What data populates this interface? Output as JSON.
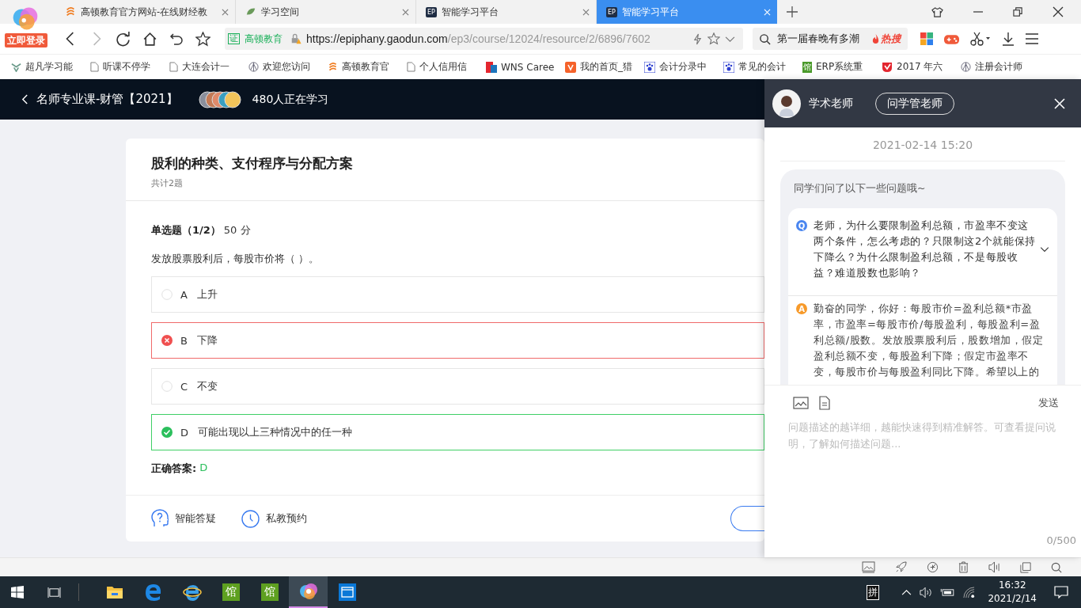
{
  "browser": {
    "login_badge": "立即登录",
    "tabs": [
      {
        "title": "高顿教育官方网站-在线财经教",
        "kind": "gaodun",
        "selected": false
      },
      {
        "title": "学习空间",
        "kind": "leaf",
        "selected": false
      },
      {
        "title": "智能学习平台",
        "kind": "ep",
        "badge": "EP",
        "selected": false
      },
      {
        "title": "智能学习平台",
        "kind": "ep",
        "badge": "EP",
        "selected": true
      }
    ],
    "cert_badge": "证",
    "site_name": "高顿教育",
    "url_host": "https://epiphany.gaodun.com",
    "url_path": "/ep3/course/12024/resource/2/6896/7602",
    "search": {
      "value": "第一届春晚有多潮",
      "hot": "热搜"
    },
    "bookmarks": [
      {
        "title": "超凡学习能",
        "kind": "leaf"
      },
      {
        "title": "听课不停学",
        "kind": "doc"
      },
      {
        "title": "大连会计一",
        "kind": "doc"
      },
      {
        "title": "欢迎您访问",
        "kind": "globe"
      },
      {
        "title": "高顿教育官",
        "kind": "gaodun"
      },
      {
        "title": "个人信用信",
        "kind": "doc"
      },
      {
        "title": "WNS Caree",
        "kind": "wns"
      },
      {
        "title": "我的首页_猎",
        "kind": "orange"
      },
      {
        "title": "会计分录中",
        "kind": "paw"
      },
      {
        "title": "常见的会计",
        "kind": "paw"
      },
      {
        "title": "ERP系统重",
        "kind": "guan",
        "badge": "馆"
      },
      {
        "title": "2017 年六",
        "kind": "red"
      },
      {
        "title": "注册会计师",
        "kind": "globe"
      }
    ]
  },
  "header": {
    "course": "名师专业课-财管【2021】",
    "learners": "480人正在学习"
  },
  "card": {
    "title": "股利的种类、支付程序与分配方案",
    "count": "共计2题",
    "qtype": "单选题（1/2）",
    "score": "50 分",
    "question": "发放股票股利后，每股市价将（ ）。",
    "options": [
      {
        "letter": "A",
        "text": "上升",
        "selected": false,
        "correct": false
      },
      {
        "letter": "B",
        "text": "下降",
        "selected": true,
        "correct": false
      },
      {
        "letter": "C",
        "text": "不变",
        "selected": false,
        "correct": false
      },
      {
        "letter": "D",
        "text": "可能出现以上三种情况中的任一种",
        "selected": false,
        "correct": true
      }
    ],
    "answer_label": "正确答案:",
    "answer_value": "D",
    "actions": [
      {
        "label": "智能答疑",
        "kind": "qa"
      },
      {
        "label": "私教预约",
        "kind": "clock"
      }
    ]
  },
  "panel": {
    "teacher": "学术老师",
    "ask_button": "问学管老师",
    "date": "2021-02-14 15:20",
    "intro": "同学们问了以下一些问题哦~",
    "q_mark": "Q",
    "question": "老师，为什么要限制盈利总额，市盈率不变这两个条件，怎么考虑的？只限制这2个就能保持下降么？为什么限制盈利总额，不是每股收益？难道股数也影响？",
    "a_mark": "A",
    "answer": "勤奋的同学，你好：每股市价=盈利总额*市盈率，市盈率=每股市价/每股盈利，每股盈利=盈利总额/股数。发放股票股利后，股数增加，假定盈利总额不变，每股盈利下降；假定市盈率不变，每股市价与每股盈利同比下降。希望以上的",
    "send": "发送",
    "placeholder": "问题描述的越详细，越能快速得到精准解答。可查看提问说明，了解如何描述问题...",
    "counter": "0/500"
  },
  "taskbar": {
    "apps": [
      {
        "kind": "explorer",
        "selected": false
      },
      {
        "kind": "edge",
        "selected": false
      },
      {
        "kind": "ie",
        "selected": false
      },
      {
        "kind": "guan",
        "badge": "馆",
        "selected": false
      },
      {
        "kind": "guan",
        "badge": "馆",
        "selected": false
      },
      {
        "kind": "browser",
        "selected": true
      },
      {
        "kind": "window",
        "selected": false
      }
    ],
    "ime": "拼",
    "time": "16:32",
    "date": "2021/2/14"
  }
}
